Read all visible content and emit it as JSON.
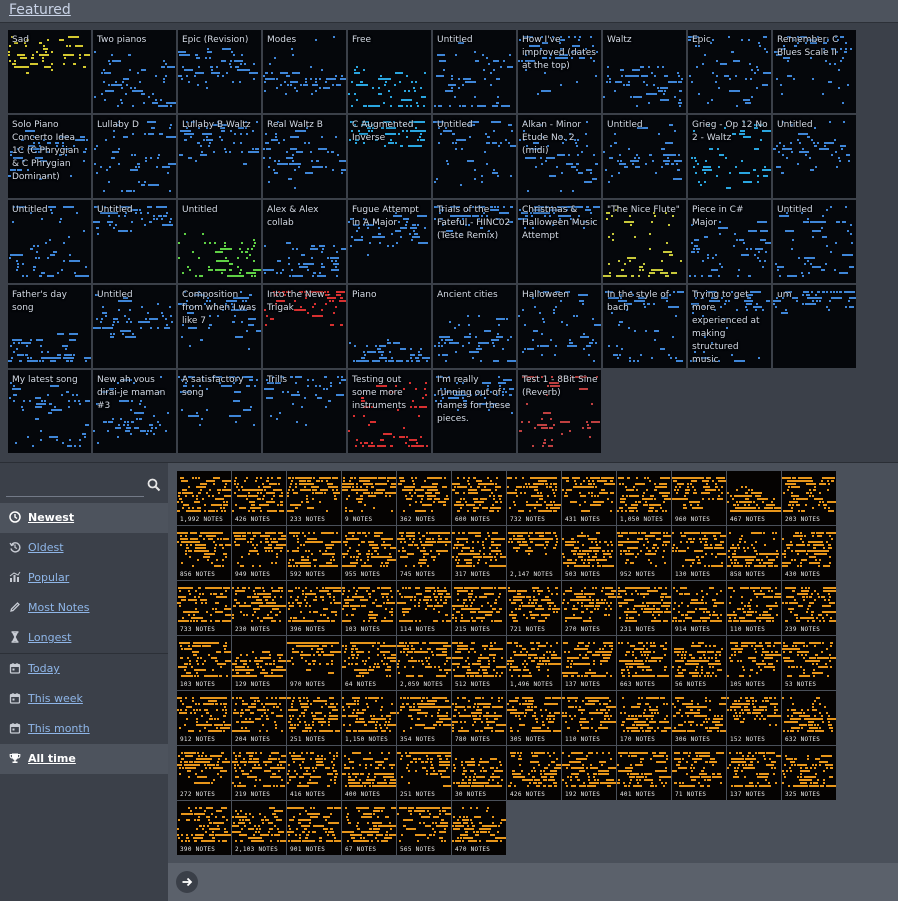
{
  "header": {
    "title": "Featured"
  },
  "featured": [
    {
      "title": "Sad",
      "color": "#d4c830"
    },
    {
      "title": "Two pianos",
      "color": "#3f86d8"
    },
    {
      "title": "Epic (Revision)",
      "color": "#3f86d8"
    },
    {
      "title": "Modes",
      "color": "#3f86d8"
    },
    {
      "title": "Free",
      "color": "#2aa6e0"
    },
    {
      "title": "Untitled",
      "color": "#3f86d8"
    },
    {
      "title": "How I've improved (dates at the top)",
      "color": "#3f86d8"
    },
    {
      "title": "Waltz",
      "color": "#3f86d8"
    },
    {
      "title": "Epic",
      "color": "#3f86d8"
    },
    {
      "title": "Remember: C Blues Scale II",
      "color": "#3f86d8"
    },
    {
      "title": "Solo Piano Concerto Idea 1C (C Phrygian & C Phrygian Dominant)",
      "color": "#3f86d8"
    },
    {
      "title": "Lullaby D",
      "color": "#3f86d8"
    },
    {
      "title": "Lullaby B Waltz",
      "color": "#3f86d8"
    },
    {
      "title": "Real Waltz B",
      "color": "#3f86d8"
    },
    {
      "title": "C Augmented Inverse",
      "color": "#2aa6e0"
    },
    {
      "title": "Untitled",
      "color": "#3f86d8"
    },
    {
      "title": "Alkan - Minor Etude No. 2 (midi)",
      "color": "#3f86d8"
    },
    {
      "title": "Untitled",
      "color": "#3f86d8"
    },
    {
      "title": "Grieg - Op 12 No 2 - Waltz",
      "color": "#2aa6e0"
    },
    {
      "title": "Untitled",
      "color": "#3f86d8"
    },
    {
      "title": "Untitled",
      "color": "#3f86d8"
    },
    {
      "title": "Untitled",
      "color": "#3f86d8"
    },
    {
      "title": "Untitled",
      "color": "#5fd045"
    },
    {
      "title": "Alex & Alex collab",
      "color": "#3f86d8"
    },
    {
      "title": "Fugue Attempt in A Major",
      "color": "#3f86d8"
    },
    {
      "title": "Trials of the Fateful - HINC02 (Teste Remix)",
      "color": "#3f86d8"
    },
    {
      "title": "Christmas & Halloween Music Attempt",
      "color": "#3f86d8"
    },
    {
      "title": "\"The Nice Flute\"",
      "color": "#c8c83a"
    },
    {
      "title": "Piece in C# Major",
      "color": "#3f86d8"
    },
    {
      "title": "Untitled",
      "color": "#3f86d8"
    },
    {
      "title": "Father's day song",
      "color": "#3f86d8"
    },
    {
      "title": "Untitled",
      "color": "#3f86d8"
    },
    {
      "title": "Composition from when I was like 7",
      "color": "#3f86d8"
    },
    {
      "title": "Into the New - Trigak",
      "color": "#d83030"
    },
    {
      "title": "Piano",
      "color": "#3f86d8"
    },
    {
      "title": "Ancient cities",
      "color": "#3f86d8"
    },
    {
      "title": "Halloween",
      "color": "#3f86d8"
    },
    {
      "title": "In the style of bach",
      "color": "#3f86d8"
    },
    {
      "title": "Trying to get more experienced at making structured music",
      "color": "#3f86d8"
    },
    {
      "title": "um",
      "color": "#3f86d8"
    },
    {
      "title": "My latest song",
      "color": "#3f86d8"
    },
    {
      "title": "New ah vous dirai-je maman #3",
      "color": "#3f86d8"
    },
    {
      "title": "A satisfactory song",
      "color": "#3f86d8"
    },
    {
      "title": "Trills",
      "color": "#3f86d8"
    },
    {
      "title": "Testing out some more instruments",
      "color": "#d83030"
    },
    {
      "title": "I'm really running out of names for these pieces.",
      "color": "#3f86d8"
    },
    {
      "title": "Test 1 - 8Bit Sine (Reverb)",
      "color": "#c04040"
    }
  ],
  "search": {
    "placeholder": ""
  },
  "sort_options": [
    {
      "label": "Newest",
      "icon": "clock-icon",
      "active": true
    },
    {
      "label": "Oldest",
      "icon": "history-icon",
      "active": false
    },
    {
      "label": "Popular",
      "icon": "chart-icon",
      "active": false
    },
    {
      "label": "Most Notes",
      "icon": "pencil-icon",
      "active": false
    },
    {
      "label": "Longest",
      "icon": "hourglass-icon",
      "active": false
    }
  ],
  "time_options": [
    {
      "label": "Today",
      "icon": "calendar-icon",
      "active": false
    },
    {
      "label": "This week",
      "icon": "calendar-icon",
      "active": false
    },
    {
      "label": "This month",
      "icon": "calendar-icon",
      "active": false
    },
    {
      "label": "All time",
      "icon": "trophy-icon",
      "active": true
    }
  ],
  "notes_color": "#e8961a",
  "note_counts": [
    "1,992 NOTES",
    "426 NOTES",
    "233 NOTES",
    "9 NOTES",
    "362 NOTES",
    "600 NOTES",
    "732 NOTES",
    "431 NOTES",
    "1,050 NOTES",
    "960 NOTES",
    "467 NOTES",
    "203 NOTES",
    "856 NOTES",
    "949 NOTES",
    "592 NOTES",
    "955 NOTES",
    "745 NOTES",
    "317 NOTES",
    "2,147 NOTES",
    "503 NOTES",
    "952 NOTES",
    "130 NOTES",
    "858 NOTES",
    "430 NOTES",
    "733 NOTES",
    "230 NOTES",
    "396 NOTES",
    "103 NOTES",
    "114 NOTES",
    "215 NOTES",
    "721 NOTES",
    "270 NOTES",
    "231 NOTES",
    "914 NOTES",
    "110 NOTES",
    "239 NOTES",
    "103 NOTES",
    "129 NOTES",
    "970 NOTES",
    "64 NOTES",
    "2,059 NOTES",
    "512 NOTES",
    "1,496 NOTES",
    "137 NOTES",
    "663 NOTES",
    "56 NOTES",
    "105 NOTES",
    "53 NOTES",
    "912 NOTES",
    "204 NOTES",
    "251 NOTES",
    "1,150 NOTES",
    "354 NOTES",
    "780 NOTES",
    "305 NOTES",
    "110 NOTES",
    "170 NOTES",
    "306 NOTES",
    "152 NOTES",
    "632 NOTES",
    "272 NOTES",
    "219 NOTES",
    "416 NOTES",
    "400 NOTES",
    "251 NOTES",
    "30 NOTES",
    "426 NOTES",
    "192 NOTES",
    "401 NOTES",
    "71 NOTES",
    "137 NOTES",
    "325 NOTES",
    "390 NOTES",
    "2,103 NOTES",
    "901 NOTES",
    "67 NOTES",
    "565 NOTES",
    "470 NOTES"
  ],
  "pagination": {
    "next_icon": "arrow-right-icon"
  }
}
